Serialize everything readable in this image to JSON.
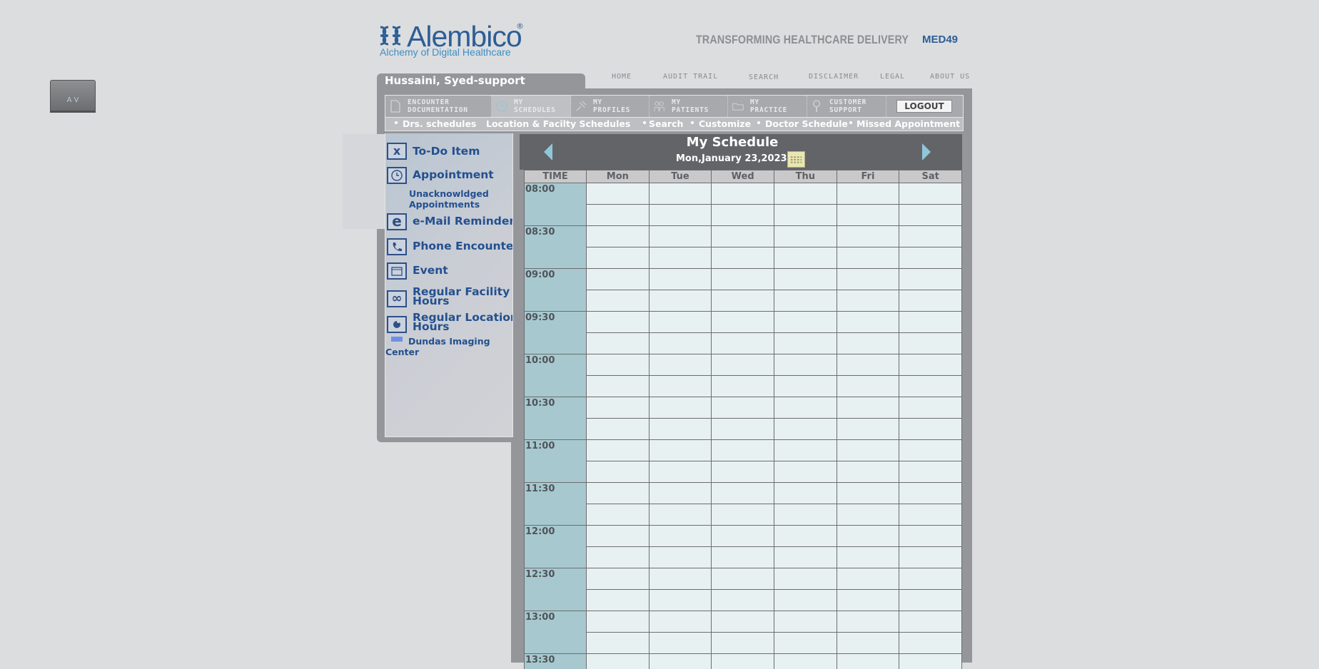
{
  "av_button": {
    "label": "A V"
  },
  "brand": {
    "name": "Alembico",
    "registered": "®",
    "tagline": "Alchemy of Digital Healthcare",
    "slogan": "TRANSFORMING HEALTHCARE DELIVERY",
    "partner": "MED49",
    "color": "#2d5e96"
  },
  "top_nav": [
    "HOME",
    "AUDIT TRAIL",
    "SEARCH",
    "DISCLAIMER",
    "LEGAL",
    "ABOUT US"
  ],
  "user": {
    "name": "Hussaini, Syed-support"
  },
  "modules": [
    {
      "label": "ENCOUNTER\nDOCUMENTATION",
      "icon": "document-icon"
    },
    {
      "label": "MY\nSCHEDULES",
      "icon": "clock-icon"
    },
    {
      "label": "MY\nPROFILES",
      "icon": "pin-icon"
    },
    {
      "label": "MY\nPATIENTS",
      "icon": "people-icon"
    },
    {
      "label": "MY\nPRACTICE",
      "icon": "folder-icon"
    },
    {
      "label": "CUSTOMER\nSUPPORT",
      "icon": "magnifier-icon"
    }
  ],
  "logout": {
    "label": "LOGOUT"
  },
  "sub_nav": [
    "Drs. schedules",
    "Location & Facilty Schedules",
    "Search",
    "Customize",
    "Doctor Schedule",
    "Missed Appointment"
  ],
  "left_panel": {
    "todo": {
      "glyph": "x",
      "label": "To-Do Item"
    },
    "appointment": {
      "label": "Appointment"
    },
    "unack": "Unacknowldged\nAppointments",
    "email": {
      "glyph": "e",
      "label": "e-Mail Reminder"
    },
    "phone": {
      "label": "Phone Encounter"
    },
    "event": {
      "label": "Event"
    },
    "facility": {
      "glyph": "∞",
      "label_line1": "Regular Facility",
      "label_line2": "Hours"
    },
    "location": {
      "label_line1": "Regular Location",
      "label_line2": "Hours"
    },
    "dundas_line1": "Dundas Imaging",
    "dundas_line2": "Center"
  },
  "schedule": {
    "title": "My Schedule",
    "date": "Mon,January 23,2023",
    "columns": [
      "TIME",
      "Mon",
      "Tue",
      "Wed",
      "Thu",
      "Fri",
      "Sat"
    ],
    "times": [
      "08:00",
      "08:30",
      "09:00",
      "09:30",
      "10:00",
      "10:30",
      "11:00",
      "11:30",
      "12:00",
      "12:30",
      "13:00",
      "13:30"
    ]
  }
}
